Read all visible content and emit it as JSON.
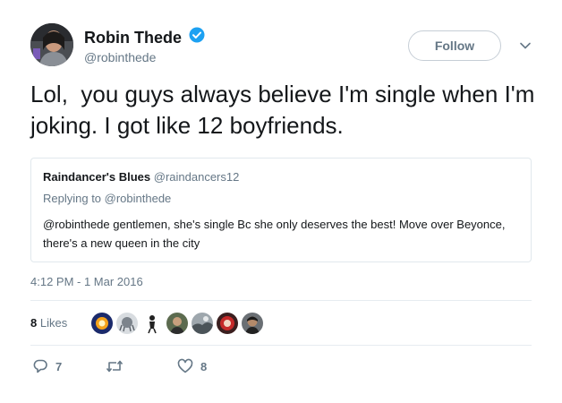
{
  "author": {
    "display_name": "Robin Thede",
    "handle": "@robinthede",
    "verified": true
  },
  "follow_button": {
    "label": "Follow"
  },
  "tweet": {
    "text": "Lol,  you guys always believe I'm single when I'm joking. I got like 12 boyfriends."
  },
  "quoted_tweet": {
    "display_name": "Raindancer's Blues",
    "handle": "@raindancers12",
    "replying_to": "Replying to @robinthede",
    "text": "@robinthede gentlemen, she's single Bc she only deserves the best! Move over Beyonce, there's a new queen in the city"
  },
  "timestamp": "4:12 PM - 1 Mar 2016",
  "likes": {
    "count": "8",
    "label": "Likes",
    "avatars": [
      "liker-1",
      "liker-2",
      "liker-3",
      "liker-4",
      "liker-5",
      "liker-6",
      "liker-7"
    ]
  },
  "actions": {
    "reply_count": "7",
    "retweet_count": "",
    "like_count": "8"
  },
  "colors": {
    "verified_blue": "#1da1f2",
    "secondary_text": "#657786",
    "border": "#e1e8ed"
  },
  "icons": {
    "verified": "verified-badge-icon",
    "caret": "chevron-down-icon",
    "reply": "reply-icon",
    "retweet": "retweet-icon",
    "like": "heart-icon"
  }
}
